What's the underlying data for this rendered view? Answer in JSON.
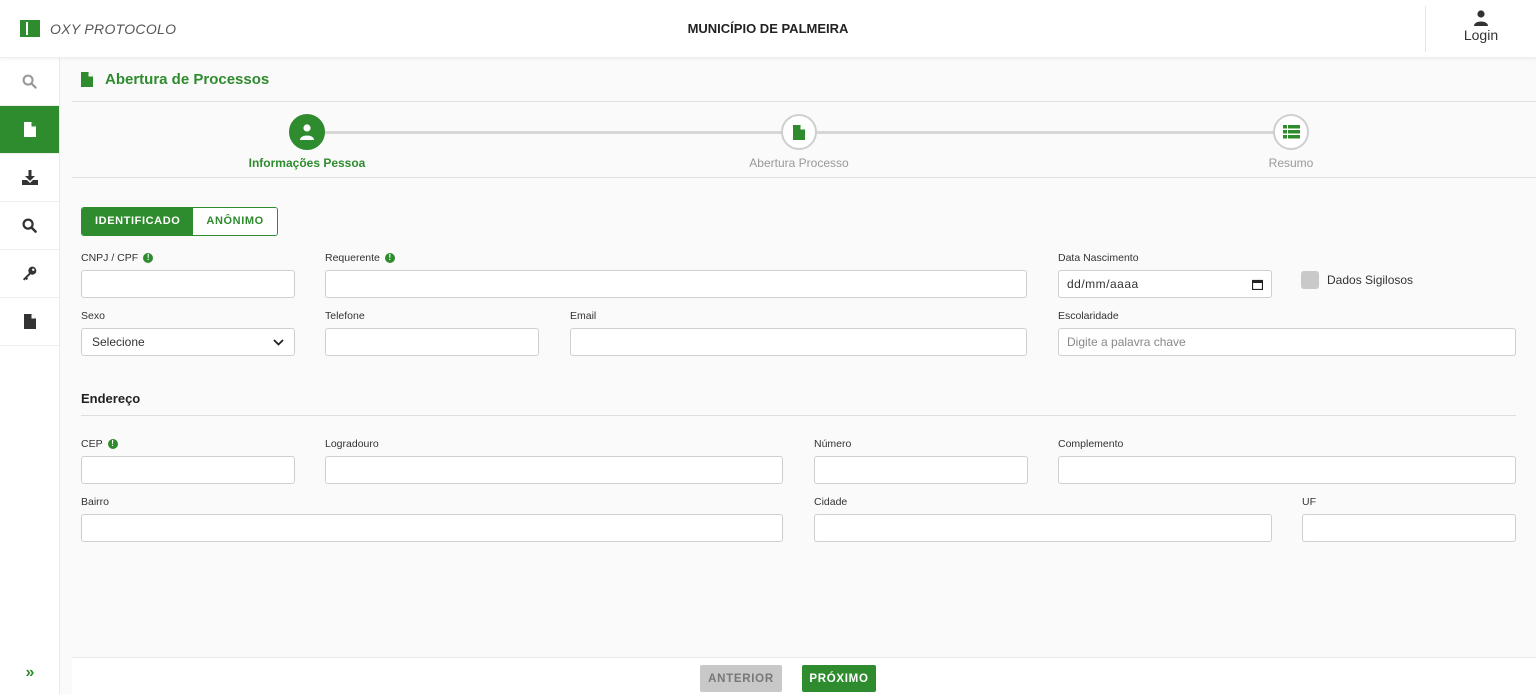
{
  "header": {
    "brand": "OXY PROTOCOLO",
    "municipality": "MUNICÍPIO DE PALMEIRA",
    "login_label": "Login"
  },
  "colors": {
    "accent": "#2e8b2e",
    "inactive_step": "#cfcfcf"
  },
  "sidebar": {
    "items": [
      {
        "icon": "search-icon",
        "active": false
      },
      {
        "icon": "file-icon",
        "active": true
      },
      {
        "icon": "download-icon",
        "active": false
      },
      {
        "icon": "search-icon",
        "active": false
      },
      {
        "icon": "key-icon",
        "active": false
      },
      {
        "icon": "file-icon",
        "active": false
      }
    ],
    "expand_label": "»"
  },
  "page": {
    "title": "Abertura de Processos"
  },
  "stepper": {
    "steps": [
      {
        "label": "Informações Pessoa",
        "icon": "user-icon",
        "active": true
      },
      {
        "label": "Abertura Processo",
        "icon": "file-icon",
        "active": false
      },
      {
        "label": "Resumo",
        "icon": "list-icon",
        "active": false
      }
    ]
  },
  "identity_toggle": {
    "options": [
      "IDENTIFICADO",
      "ANÔNIMO"
    ],
    "selected": "IDENTIFICADO"
  },
  "form": {
    "cnpj_cpf": {
      "label": "CNPJ / CPF",
      "value": ""
    },
    "requerente": {
      "label": "Requerente",
      "value": ""
    },
    "data_nascimento": {
      "label": "Data Nascimento",
      "placeholder": "dd/mm/aaaa"
    },
    "dados_sigilosos": {
      "label": "Dados Sigilosos",
      "checked": false
    },
    "sexo": {
      "label": "Sexo",
      "selected": "Selecione"
    },
    "telefone": {
      "label": "Telefone",
      "value": ""
    },
    "email": {
      "label": "Email",
      "value": ""
    },
    "escolaridade": {
      "label": "Escolaridade",
      "placeholder": "Digite a palavra chave"
    }
  },
  "address": {
    "section_title": "Endereço",
    "cep": {
      "label": "CEP",
      "value": ""
    },
    "logradouro": {
      "label": "Logradouro",
      "value": ""
    },
    "numero": {
      "label": "Número",
      "value": ""
    },
    "complemento": {
      "label": "Complemento",
      "value": ""
    },
    "bairro": {
      "label": "Bairro",
      "value": ""
    },
    "cidade": {
      "label": "Cidade",
      "value": ""
    },
    "uf": {
      "label": "UF",
      "value": ""
    }
  },
  "footer": {
    "prev_label": "ANTERIOR",
    "next_label": "PRÓXIMO"
  }
}
